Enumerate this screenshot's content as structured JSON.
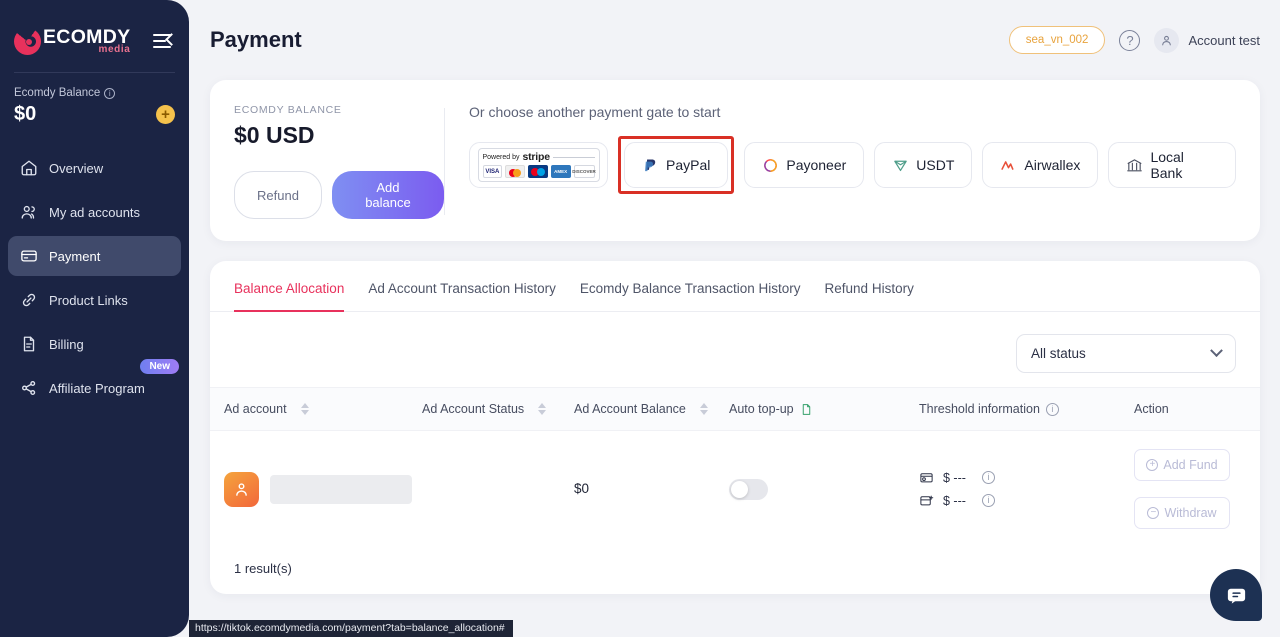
{
  "sidebar": {
    "logo": {
      "word": "ECOMDY",
      "sub": "media"
    },
    "collapse_icon": "hamburger-collapse-icon",
    "balance": {
      "label": "Ecomdy Balance",
      "amount": "$0",
      "add_icon": "plus-icon"
    },
    "items": [
      {
        "label": "Overview",
        "icon": "home-icon",
        "active": false
      },
      {
        "label": "My ad accounts",
        "icon": "users-icon",
        "active": false
      },
      {
        "label": "Payment",
        "icon": "credit-card-icon",
        "active": true
      },
      {
        "label": "Product Links",
        "icon": "link-icon",
        "active": false
      },
      {
        "label": "Billing",
        "icon": "document-icon",
        "active": false
      },
      {
        "label": "Affiliate Program",
        "icon": "share-icon",
        "active": false,
        "badge": "New"
      }
    ]
  },
  "header": {
    "title": "Payment",
    "account_chip": "sea_vn_002",
    "help_icon": "question-mark-icon",
    "user_name": "Account test",
    "avatar_icon": "person-icon"
  },
  "payment_card": {
    "balance_label": "ECOMDY BALANCE",
    "balance_amount": "$0 USD",
    "refund_label": "Refund",
    "add_balance_label": "Add balance",
    "gate_title": "Or choose another payment gate to start",
    "stripe": {
      "powered_by": "Powered by",
      "brand": "stripe",
      "cards": [
        "VISA",
        "Mastercard",
        "Maestro",
        "AMEX",
        "DISCOVER"
      ]
    },
    "gateways": [
      {
        "label": "PayPal",
        "icon": "paypal-icon",
        "highlighted": true
      },
      {
        "label": "Payoneer",
        "icon": "payoneer-icon",
        "highlighted": false
      },
      {
        "label": "USDT",
        "icon": "usdt-icon",
        "highlighted": false
      },
      {
        "label": "Airwallex",
        "icon": "airwallex-icon",
        "highlighted": false
      },
      {
        "label": "Local Bank",
        "icon": "bank-icon",
        "highlighted": false
      }
    ],
    "highlight_color": "#d93025"
  },
  "tabs": [
    {
      "label": "Balance Allocation",
      "active": true
    },
    {
      "label": "Ad Account Transaction History",
      "active": false
    },
    {
      "label": "Ecomdy Balance Transaction History",
      "active": false
    },
    {
      "label": "Refund History",
      "active": false
    }
  ],
  "filter": {
    "status_value": "All status",
    "chevron_icon": "chevron-down-icon"
  },
  "table": {
    "columns": [
      {
        "label": "Ad account",
        "sortable": true
      },
      {
        "label": "Ad Account Status",
        "sortable": true
      },
      {
        "label": "Ad Account Balance",
        "sortable": true
      },
      {
        "label": "Auto top-up",
        "sortable": false,
        "icon": "document-green-icon"
      },
      {
        "label": "Threshold information",
        "sortable": false,
        "icon": "info-icon"
      },
      {
        "label": "Action",
        "sortable": false
      }
    ],
    "rows": [
      {
        "avatar_icon": "person-orange-icon",
        "account_name": "",
        "status": "",
        "balance": "$0",
        "auto_topup_on": false,
        "threshold": [
          {
            "icon": "wallet-icon",
            "value": "$ ---",
            "info_icon": "info-icon"
          },
          {
            "icon": "card-add-icon",
            "value": "$ ---",
            "info_icon": "info-icon"
          }
        ],
        "actions": [
          {
            "label": "Add Fund",
            "icon": "plus-circle-icon",
            "disabled": true
          },
          {
            "label": "Withdraw",
            "icon": "minus-circle-icon",
            "disabled": true
          }
        ]
      }
    ],
    "result_text": "1 result(s)"
  },
  "chat_widget": {
    "icon": "chat-bubble-icon"
  },
  "statusbar": {
    "url": "https://tiktok.ecomdymedia.com/payment?tab=balance_allocation#"
  },
  "colors": {
    "sidebar_bg": "#1b2444",
    "accent_pink": "#e8315c",
    "chip_orange": "#e8a33d",
    "highlight_red": "#d93025",
    "gradient_purple": "#7b5cf0"
  }
}
